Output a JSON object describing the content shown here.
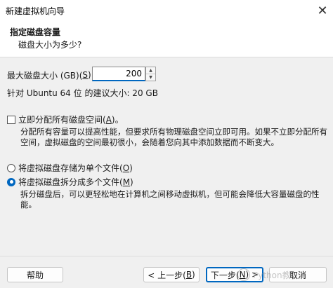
{
  "window": {
    "title": "新建虚拟机向导",
    "close_glyph": "✕"
  },
  "header": {
    "title": "指定磁盘容量",
    "subtitle": "磁盘大小为多少?"
  },
  "disk_size": {
    "label_prefix": "最大磁盘大小 (GB)(",
    "label_key": "S",
    "label_suffix": "):",
    "value": "200",
    "recommendation": "针对 Ubuntu 64 位 的建议大小: 20 GB"
  },
  "allocate": {
    "label_prefix": "立即分配所有磁盘空间(",
    "label_key": "A",
    "label_suffix": ")。",
    "checked": false,
    "description": "分配所有容量可以提高性能，但要求所有物理磁盘空间立即可用。如果不立即分配所有空间，虚拟磁盘的空间最初很小，会随着您向其中添加数据而不断变大。"
  },
  "storage_options": [
    {
      "label_prefix": "将虚拟磁盘存储为单个文件(",
      "label_key": "O",
      "label_suffix": ")",
      "selected": false
    },
    {
      "label_prefix": "将虚拟磁盘拆分成多个文件(",
      "label_key": "M",
      "label_suffix": ")",
      "selected": true,
      "description": "拆分磁盘后，可以更轻松地在计算机之间移动虚拟机，但可能会降低大容量磁盘的性能。"
    }
  ],
  "buttons": {
    "help": "帮助",
    "back_prefix": "< 上一步(",
    "back_key": "B",
    "back_suffix": ")",
    "next_prefix": "下一步(",
    "next_key": "N",
    "next_suffix": ") >",
    "cancel": "取消"
  },
  "watermark": {
    "text": "Python教"
  },
  "colors": {
    "accent": "#0067c0",
    "background": "#f0f0f0",
    "header_bg": "#ffffff"
  }
}
